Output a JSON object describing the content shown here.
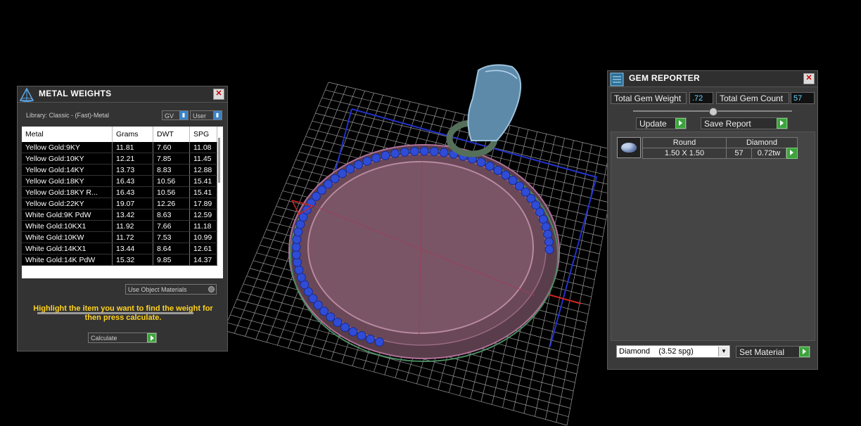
{
  "metal_weights": {
    "title": "METAL WEIGHTS",
    "library": "Library: Classic - (Fast)-Metal",
    "dd1": "GV",
    "dd2": "User",
    "columns": [
      "Metal",
      "Grams",
      "DWT",
      "SPG"
    ],
    "rows": [
      [
        "Yellow Gold:9KY",
        "11.81",
        "7.60",
        "11.08"
      ],
      [
        "Yellow Gold:10KY",
        "12.21",
        "7.85",
        "11.45"
      ],
      [
        "Yellow Gold:14KY",
        "13.73",
        "8.83",
        "12.88"
      ],
      [
        "Yellow Gold:18KY",
        "16.43",
        "10.56",
        "15.41"
      ],
      [
        "Yellow Gold:18KY R...",
        "16.43",
        "10.56",
        "15.41"
      ],
      [
        "Yellow Gold:22KY",
        "19.07",
        "12.26",
        "17.89"
      ],
      [
        "White Gold:9K PdW",
        "13.42",
        "8.63",
        "12.59"
      ],
      [
        "White Gold:10KX1",
        "11.92",
        "7.66",
        "11.18"
      ],
      [
        "White Gold:10KW",
        "11.72",
        "7.53",
        "10.99"
      ],
      [
        "White Gold:14KX1",
        "13.44",
        "8.64",
        "12.61"
      ],
      [
        "White Gold:14K PdW",
        "15.32",
        "9.85",
        "14.37"
      ]
    ],
    "use_object_materials": "Use Object Materials",
    "hint": "Highlight the item you want to find the weight for then press calculate.",
    "calculate": "Calculate"
  },
  "gem_reporter": {
    "title": "GEM REPORTER",
    "total_weight_label": "Total Gem Weight",
    "total_weight_value": ".72",
    "total_count_label": "Total Gem Count",
    "total_count_value": "57",
    "update": "Update",
    "save_report": "Save Report",
    "gem": {
      "shape": "Round",
      "material": "Diamond",
      "size": "1.50 X 1.50",
      "count": "57",
      "weight": "0.72tw"
    },
    "material_select": "Diamond    (3.52 spg)",
    "set_material": "Set Material"
  }
}
